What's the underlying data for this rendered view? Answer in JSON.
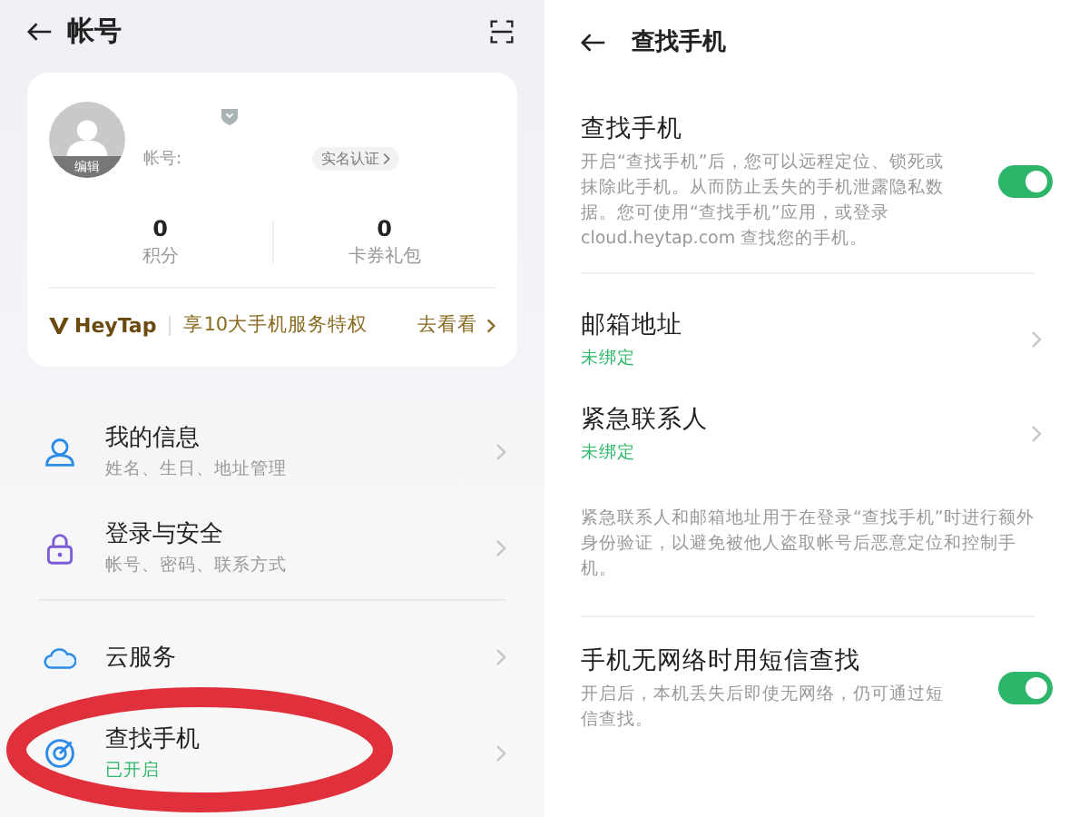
{
  "left": {
    "header": {
      "title": "帐号"
    },
    "profile": {
      "avatar_label": "编辑",
      "account_label": "帐号:",
      "verify_chip": "实名认证"
    },
    "stats": [
      {
        "value": "0",
        "label": "积分"
      },
      {
        "value": "0",
        "label": "卡券礼包"
      }
    ],
    "promo": {
      "brand": "HeyTap",
      "text": "享10大手机服务特权",
      "link": "去看看"
    },
    "menu_groups": [
      [
        {
          "title": "我的信息",
          "subtitle": "姓名、生日、地址管理",
          "kind": "hint"
        },
        {
          "title": "登录与安全",
          "subtitle": "帐号、密码、联系方式",
          "kind": "hint"
        }
      ],
      [
        {
          "title": "云服务"
        },
        {
          "title": "查找手机",
          "subtitle": "已开启",
          "kind": "status"
        }
      ]
    ],
    "annotation": {
      "kind": "ellipse",
      "color": "#e0303c"
    }
  },
  "right": {
    "header": {
      "title": "查找手机"
    },
    "sections": [
      {
        "kind": "toggle",
        "title": "查找手机",
        "description": "开启“查找手机”后，您可以远程定位、锁死或抹除此手机。从而防止丢失的手机泄露隐私数据。您可使用“查找手机”应用，或登录cloud.heytap.com 查找您的手机。",
        "on": true
      },
      {
        "kind": "links",
        "items": [
          {
            "title": "邮箱地址",
            "status": "未绑定"
          },
          {
            "title": "紧急联系人",
            "status": "未绑定"
          }
        ],
        "note": "紧急联系人和邮箱地址用于在登录“查找手机”时进行额外身份验证，以避免被他人盗取帐号后恶意定位和控制手机。"
      },
      {
        "kind": "toggle",
        "title": "手机无网络时用短信查找",
        "description": "开启后，本机丢失后即使无网络，仍可通过短信查找。",
        "on": true
      }
    ]
  }
}
